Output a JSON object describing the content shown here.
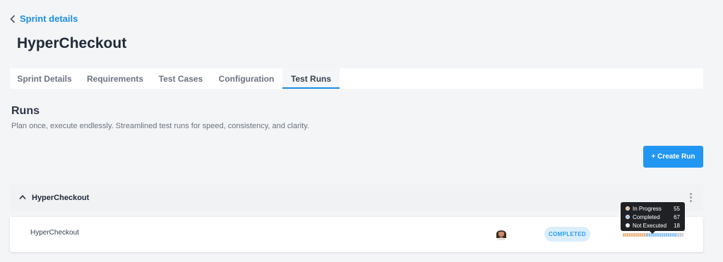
{
  "nav": {
    "back_label": "Sprint details"
  },
  "page": {
    "title": "HyperCheckout"
  },
  "tabs": [
    {
      "label": "Sprint Details",
      "active": false
    },
    {
      "label": "Requirements",
      "active": false
    },
    {
      "label": "Test Cases",
      "active": false
    },
    {
      "label": "Configuration",
      "active": false
    },
    {
      "label": "Test Runs",
      "active": true
    }
  ],
  "section": {
    "title": "Runs",
    "subtitle": "Plan once, execute endlessly. Streamlined test runs for speed, consistency, and clarity."
  },
  "actions": {
    "create_run_label": "+ Create Run"
  },
  "group": {
    "name": "HyperCheckout",
    "runs": [
      {
        "name": "HyperCheckout",
        "status": "COMPLETED",
        "progress": {
          "in_progress": 55,
          "completed": 67,
          "not_executed": 18
        }
      }
    ]
  },
  "tooltip": {
    "items": [
      {
        "label": "In Progress",
        "value": "55",
        "color": "#e9b887"
      },
      {
        "label": "Completed",
        "value": "67",
        "color": "#8cc5f3"
      },
      {
        "label": "Not Executed",
        "value": "18",
        "color": "#e5e7eb"
      }
    ]
  },
  "colors": {
    "accent": "#1a8fe3",
    "button": "#2196f3",
    "status_completed_bg": "#dbeefc",
    "status_completed_text": "#2a9df4"
  }
}
